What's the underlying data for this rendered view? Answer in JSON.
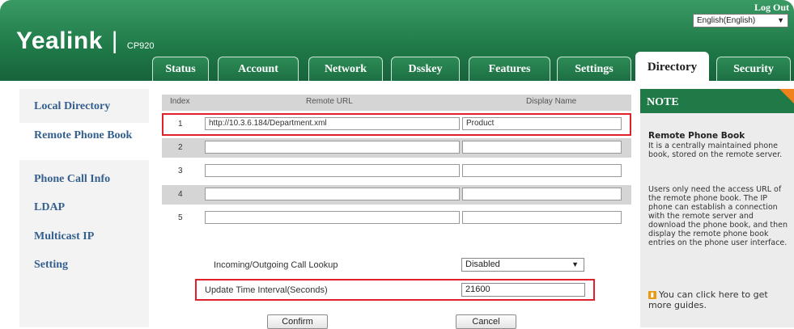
{
  "header": {
    "brand": "Yealink",
    "separator": "|",
    "model": "CP920",
    "logout": "Log Out",
    "language": "English(English)"
  },
  "tabs": [
    {
      "label": "Status"
    },
    {
      "label": "Account"
    },
    {
      "label": "Network"
    },
    {
      "label": "Dsskey"
    },
    {
      "label": "Features"
    },
    {
      "label": "Settings"
    },
    {
      "label": "Directory",
      "active": true
    },
    {
      "label": "Security"
    }
  ],
  "sidebar": {
    "items": [
      {
        "label": "Local Directory"
      },
      {
        "label": "Remote Phone Book",
        "active": true
      },
      {
        "label": "Phone Call Info"
      },
      {
        "label": "LDAP"
      },
      {
        "label": "Multicast IP"
      },
      {
        "label": "Setting"
      }
    ]
  },
  "table": {
    "headers": [
      "Index",
      "Remote URL",
      "Display Name"
    ],
    "rows": [
      {
        "index": "1",
        "url": "http://10.3.6.184/Department.xml",
        "name": "Product"
      },
      {
        "index": "2",
        "url": "",
        "name": ""
      },
      {
        "index": "3",
        "url": "",
        "name": ""
      },
      {
        "index": "4",
        "url": "",
        "name": ""
      },
      {
        "index": "5",
        "url": "",
        "name": ""
      }
    ]
  },
  "settings": {
    "lookup_label": "Incoming/Outgoing Call Lookup",
    "lookup_value": "Disabled",
    "interval_label": "Update Time Interval(Seconds)",
    "interval_value": "21600"
  },
  "buttons": {
    "confirm": "Confirm",
    "cancel": "Cancel"
  },
  "note": {
    "title": "NOTE",
    "heading": "Remote Phone Book",
    "p1": "It is a centrally maintained phone book, stored on the remote server.",
    "p2": "Users only need the access URL of the remote phone book. The IP phone can establish a connection with the remote server and download the phone book, and then display the remote phone book entries on the phone user interface.",
    "guide": "You can click here to get more guides.",
    "guide_icon": "book-icon"
  },
  "colors": {
    "brand_green": "#1f7a48",
    "nav_link": "#35608e",
    "highlight": "#e0202a",
    "note_corner": "#f0821e"
  }
}
